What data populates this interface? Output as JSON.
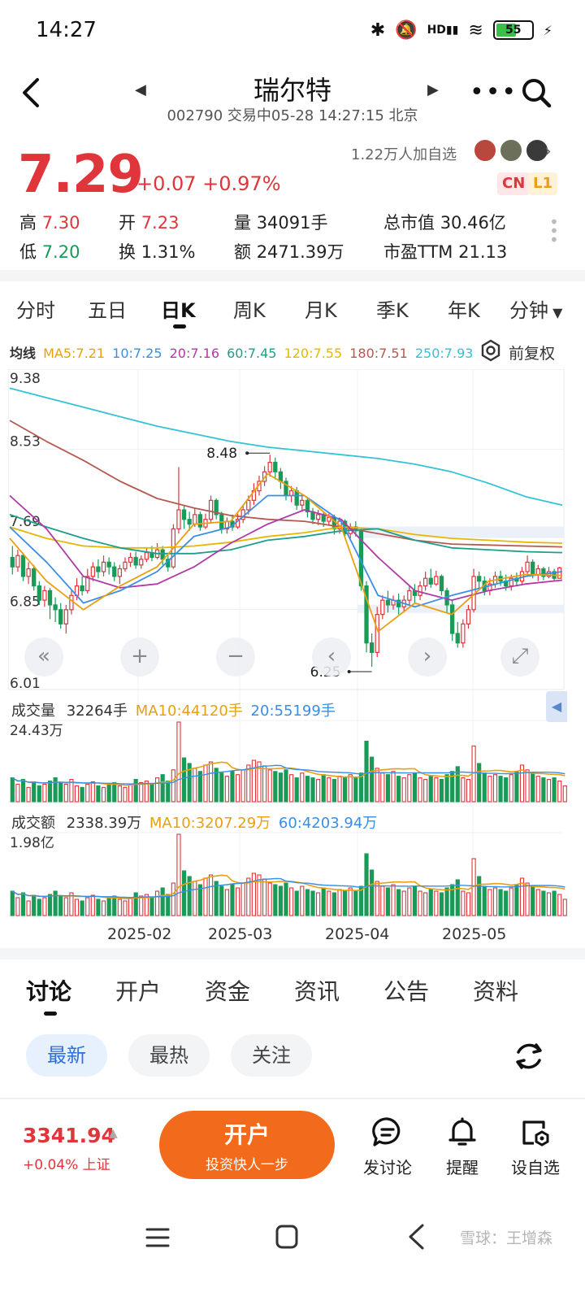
{
  "status_bar": {
    "time": "14:27",
    "battery": "55",
    "network": "HD"
  },
  "header": {
    "title": "瑞尔特",
    "subtitle": "002790 交易中05-28 14:27:15 北京"
  },
  "quote": {
    "price": "7.29",
    "change": "+0.07 +0.97%",
    "followers": "1.22万人加自选",
    "badge_cn": "CN",
    "badge_l1": "L1",
    "stats": [
      {
        "label": "高",
        "value": "7.30"
      },
      {
        "label": "开",
        "value": "7.23"
      },
      {
        "label": "量",
        "value": "34091手"
      },
      {
        "label": "总市值",
        "value": "30.46亿"
      },
      {
        "label": "低",
        "value": "7.20"
      },
      {
        "label": "换",
        "value": "1.31%"
      },
      {
        "label": "额",
        "value": "2471.39万"
      },
      {
        "label": "市盈TTM",
        "value": "21.13"
      }
    ]
  },
  "period_tabs": [
    "分时",
    "五日",
    "日K",
    "周K",
    "月K",
    "季K",
    "年K",
    "分钟"
  ],
  "period_active": "日K",
  "ma_legend": {
    "title": "均线",
    "items": [
      {
        "text": "MA5:7.21",
        "color": "#e8a012"
      },
      {
        "text": "10:7.25",
        "color": "#3a8ee6"
      },
      {
        "text": "20:7.16",
        "color": "#b03aa6"
      },
      {
        "text": "60:7.45",
        "color": "#1f9e8a"
      },
      {
        "text": "120:7.55",
        "color": "#e6b800"
      },
      {
        "text": "180:7.51",
        "color": "#b55a50"
      },
      {
        "text": "250:7.93",
        "color": "#34c2d6"
      }
    ],
    "adjust_label": "前复权"
  },
  "chart_data": {
    "type": "candlestick",
    "y_ticks": [
      "9.38",
      "8.53",
      "7.69",
      "6.85",
      "6.01"
    ],
    "ylim": [
      6.01,
      9.38
    ],
    "high_marker": "8.48",
    "low_marker": "6.25",
    "x_labels": [
      "2025-02",
      "2025-03",
      "2025-04",
      "2025-05"
    ],
    "candles": [
      [
        7.4,
        7.3,
        7.52,
        7.22
      ],
      [
        7.3,
        7.42,
        7.48,
        7.25
      ],
      [
        7.42,
        7.2,
        7.45,
        7.15
      ],
      [
        7.2,
        7.28,
        7.35,
        7.12
      ],
      [
        7.28,
        7.1,
        7.32,
        7.05
      ],
      [
        7.1,
        6.95,
        7.15,
        6.9
      ],
      [
        6.95,
        7.05,
        7.1,
        6.88
      ],
      [
        7.05,
        6.9,
        7.08,
        6.75
      ],
      [
        6.9,
        6.85,
        6.98,
        6.72
      ],
      [
        6.85,
        6.7,
        6.92,
        6.65
      ],
      [
        6.7,
        6.85,
        6.9,
        6.6
      ],
      [
        6.85,
        7.0,
        7.05,
        6.8
      ],
      [
        7.0,
        7.1,
        7.18,
        6.95
      ],
      [
        7.1,
        7.05,
        7.2,
        7.0
      ],
      [
        7.05,
        7.2,
        7.28,
        7.02
      ],
      [
        7.2,
        7.3,
        7.35,
        7.15
      ],
      [
        7.3,
        7.25,
        7.38,
        7.18
      ],
      [
        7.25,
        7.35,
        7.42,
        7.2
      ],
      [
        7.35,
        7.3,
        7.4,
        7.22
      ],
      [
        7.3,
        7.2,
        7.35,
        7.15
      ],
      [
        7.2,
        7.28,
        7.32,
        7.12
      ],
      [
        7.28,
        7.35,
        7.4,
        7.25
      ],
      [
        7.35,
        7.4,
        7.45,
        7.3
      ],
      [
        7.4,
        7.32,
        7.46,
        7.28
      ],
      [
        7.32,
        7.38,
        7.42,
        7.28
      ],
      [
        7.38,
        7.45,
        7.5,
        7.35
      ],
      [
        7.45,
        7.4,
        7.52,
        7.36
      ],
      [
        7.4,
        7.48,
        7.55,
        7.38
      ],
      [
        7.48,
        7.38,
        7.52,
        7.32
      ],
      [
        7.38,
        7.3,
        7.42,
        7.25
      ],
      [
        7.3,
        7.7,
        7.75,
        7.28
      ],
      [
        7.7,
        7.9,
        8.35,
        7.65
      ],
      [
        7.9,
        7.8,
        7.95,
        7.7
      ],
      [
        7.8,
        7.75,
        7.88,
        7.68
      ],
      [
        7.75,
        7.85,
        7.92,
        7.72
      ],
      [
        7.85,
        7.72,
        7.88,
        7.68
      ],
      [
        7.72,
        7.8,
        7.86,
        7.7
      ],
      [
        7.8,
        8.0,
        8.05,
        7.76
      ],
      [
        8.0,
        7.85,
        8.02,
        7.8
      ],
      [
        7.85,
        7.7,
        7.88,
        7.65
      ],
      [
        7.7,
        7.78,
        7.82,
        7.65
      ],
      [
        7.78,
        7.72,
        7.85,
        7.68
      ],
      [
        7.72,
        7.8,
        7.86,
        7.7
      ],
      [
        7.8,
        7.9,
        7.95,
        7.76
      ],
      [
        7.9,
        8.0,
        8.05,
        7.85
      ],
      [
        8.0,
        8.1,
        8.18,
        7.95
      ],
      [
        8.1,
        8.2,
        8.26,
        8.05
      ],
      [
        8.2,
        8.3,
        8.36,
        8.15
      ],
      [
        8.3,
        8.4,
        8.48,
        8.25
      ],
      [
        8.4,
        8.3,
        8.45,
        8.22
      ],
      [
        8.3,
        8.2,
        8.34,
        8.12
      ],
      [
        8.2,
        8.05,
        8.24,
        8.0
      ],
      [
        8.05,
        8.1,
        8.15,
        7.98
      ],
      [
        8.1,
        7.95,
        8.14,
        7.9
      ],
      [
        7.95,
        8.0,
        8.05,
        7.88
      ],
      [
        8.0,
        7.88,
        8.03,
        7.82
      ],
      [
        7.88,
        7.8,
        7.92,
        7.75
      ],
      [
        7.8,
        7.85,
        7.9,
        7.74
      ],
      [
        7.85,
        7.78,
        7.88,
        7.72
      ],
      [
        7.78,
        7.82,
        7.86,
        7.74
      ],
      [
        7.82,
        7.7,
        7.85,
        7.64
      ],
      [
        7.7,
        7.78,
        7.82,
        7.65
      ],
      [
        7.78,
        7.65,
        7.8,
        7.6
      ],
      [
        7.65,
        7.72,
        7.76,
        7.6
      ],
      [
        7.72,
        7.68,
        7.78,
        7.62
      ],
      [
        7.68,
        7.1,
        7.7,
        7.05
      ],
      [
        7.1,
        6.5,
        7.15,
        6.4
      ],
      [
        6.5,
        6.4,
        6.6,
        6.25
      ],
      [
        6.4,
        6.8,
        6.88,
        6.35
      ],
      [
        6.8,
        6.95,
        7.0,
        6.75
      ],
      [
        6.95,
        6.9,
        7.05,
        6.82
      ],
      [
        6.9,
        6.95,
        7.0,
        6.85
      ],
      [
        6.95,
        6.88,
        7.02,
        6.8
      ],
      [
        6.88,
        6.95,
        7.0,
        6.82
      ],
      [
        6.95,
        7.05,
        7.1,
        6.9
      ],
      [
        7.05,
        7.0,
        7.12,
        6.92
      ],
      [
        7.0,
        7.1,
        7.15,
        6.95
      ],
      [
        7.1,
        7.18,
        7.25,
        7.05
      ],
      [
        7.18,
        7.12,
        7.28,
        7.08
      ],
      [
        7.12,
        7.2,
        7.26,
        7.1
      ],
      [
        7.2,
        7.05,
        7.22,
        7.0
      ],
      [
        7.05,
        6.9,
        7.08,
        6.82
      ],
      [
        6.9,
        6.6,
        6.95,
        6.52
      ],
      [
        6.6,
        6.5,
        6.72,
        6.45
      ],
      [
        6.5,
        6.7,
        6.75,
        6.45
      ],
      [
        6.7,
        6.85,
        6.9,
        6.65
      ],
      [
        6.85,
        7.2,
        7.28,
        6.82
      ],
      [
        7.2,
        7.15,
        7.25,
        7.05
      ],
      [
        7.15,
        7.05,
        7.2,
        7.0
      ],
      [
        7.05,
        7.12,
        7.18,
        7.0
      ],
      [
        7.12,
        7.2,
        7.25,
        7.08
      ],
      [
        7.2,
        7.15,
        7.26,
        7.1
      ],
      [
        7.15,
        7.1,
        7.22,
        7.05
      ],
      [
        7.1,
        7.18,
        7.22,
        7.05
      ],
      [
        7.18,
        7.15,
        7.24,
        7.1
      ],
      [
        7.15,
        7.25,
        7.3,
        7.12
      ],
      [
        7.25,
        7.35,
        7.42,
        7.2
      ],
      [
        7.35,
        7.22,
        7.38,
        7.18
      ],
      [
        7.22,
        7.28,
        7.32,
        7.15
      ],
      [
        7.28,
        7.2,
        7.3,
        7.16
      ],
      [
        7.2,
        7.25,
        7.3,
        7.18
      ],
      [
        7.25,
        7.18,
        7.28,
        7.15
      ],
      [
        7.18,
        7.29,
        7.3,
        7.2
      ]
    ],
    "ma_series": [
      {
        "name": "250",
        "color": "#34c2d6",
        "values": [
          9.18,
          9.08,
          8.98,
          8.88,
          8.78,
          8.7,
          8.62,
          8.56,
          8.52,
          8.48,
          8.44,
          8.38,
          8.3,
          8.18,
          8.04,
          7.95
        ]
      },
      {
        "name": "180",
        "color": "#b55a50",
        "values": [
          8.84,
          8.62,
          8.42,
          8.2,
          8.02,
          7.92,
          7.84,
          7.8,
          7.78,
          7.72,
          7.65,
          7.58,
          7.54,
          7.53,
          7.52,
          7.51
        ]
      },
      {
        "name": "120",
        "color": "#e6b800",
        "values": [
          7.72,
          7.6,
          7.52,
          7.5,
          7.5,
          7.52,
          7.56,
          7.62,
          7.66,
          7.72,
          7.7,
          7.64,
          7.6,
          7.58,
          7.56,
          7.55
        ]
      },
      {
        "name": "60",
        "color": "#1f9e8a",
        "values": [
          7.85,
          7.72,
          7.6,
          7.5,
          7.44,
          7.44,
          7.48,
          7.58,
          7.62,
          7.68,
          7.7,
          7.58,
          7.5,
          7.48,
          7.46,
          7.45
        ]
      },
      {
        "name": "20",
        "color": "#b03aa6",
        "values": [
          8.05,
          7.7,
          7.2,
          7.08,
          7.12,
          7.3,
          7.55,
          7.75,
          7.9,
          7.8,
          7.4,
          7.05,
          6.95,
          7.05,
          7.12,
          7.16
        ]
      },
      {
        "name": "10",
        "color": "#3a8ee6",
        "values": [
          7.72,
          7.35,
          6.92,
          7.05,
          7.25,
          7.62,
          7.72,
          8.05,
          8.05,
          7.78,
          7.0,
          6.88,
          7.0,
          7.1,
          7.2,
          7.25
        ]
      },
      {
        "name": "MA5",
        "color": "#e8a012",
        "values": [
          7.6,
          7.15,
          6.85,
          7.1,
          7.3,
          7.75,
          7.78,
          8.28,
          8.05,
          7.72,
          6.62,
          6.92,
          6.8,
          7.15,
          7.22,
          7.21
        ]
      }
    ],
    "volume": {
      "legend_title": "成交量",
      "legend_value": "32264手",
      "legend_ma10": "MA10:44120手",
      "legend_ma20": "20:55199手",
      "max_label": "24.43万"
    },
    "amount": {
      "legend_title": "成交额",
      "legend_value": "2338.39万",
      "legend_ma10": "MA10:3207.29万",
      "legend_ma60": "60:4203.94万",
      "max_label": "1.98亿"
    },
    "volume_values": [
      0.3,
      0.22,
      0.28,
      0.18,
      0.25,
      0.2,
      0.22,
      0.26,
      0.3,
      0.24,
      0.22,
      0.28,
      0.2,
      0.18,
      0.22,
      0.25,
      0.2,
      0.18,
      0.22,
      0.24,
      0.2,
      0.18,
      0.22,
      0.28,
      0.24,
      0.26,
      0.22,
      0.3,
      0.34,
      0.26,
      0.4,
      1.0,
      0.55,
      0.48,
      0.42,
      0.38,
      0.46,
      0.5,
      0.42,
      0.36,
      0.32,
      0.38,
      0.34,
      0.4,
      0.46,
      0.52,
      0.5,
      0.45,
      0.4,
      0.38,
      0.36,
      0.4,
      0.34,
      0.3,
      0.36,
      0.32,
      0.3,
      0.28,
      0.34,
      0.3,
      0.28,
      0.32,
      0.3,
      0.34,
      0.3,
      0.36,
      0.76,
      0.56,
      0.42,
      0.36,
      0.34,
      0.38,
      0.32,
      0.3,
      0.34,
      0.36,
      0.3,
      0.28,
      0.32,
      0.3,
      0.28,
      0.34,
      0.38,
      0.44,
      0.3,
      0.28,
      0.7,
      0.48,
      0.36,
      0.32,
      0.34,
      0.32,
      0.3,
      0.34,
      0.38,
      0.46,
      0.4,
      0.36,
      0.32,
      0.3,
      0.28,
      0.3,
      0.26,
      0.2
    ]
  },
  "bottom_tabs": [
    "讨论",
    "开户",
    "资金",
    "资讯",
    "公告",
    "资料"
  ],
  "bottom_tab_active": "讨论",
  "filter_pills": [
    "最新",
    "最热",
    "关注"
  ],
  "filter_active": "最新",
  "action_bar": {
    "index_value": "3341.94",
    "index_change": "+0.04% 上证",
    "open_account_title": "开户",
    "open_account_sub": "投资快人一步",
    "actions": [
      "发讨论",
      "提醒",
      "设自选"
    ]
  },
  "watermark": "雪球：王增森",
  "colors": {
    "up": "#e0353b",
    "down": "#1a9a57",
    "accent": "#f26a1b"
  }
}
